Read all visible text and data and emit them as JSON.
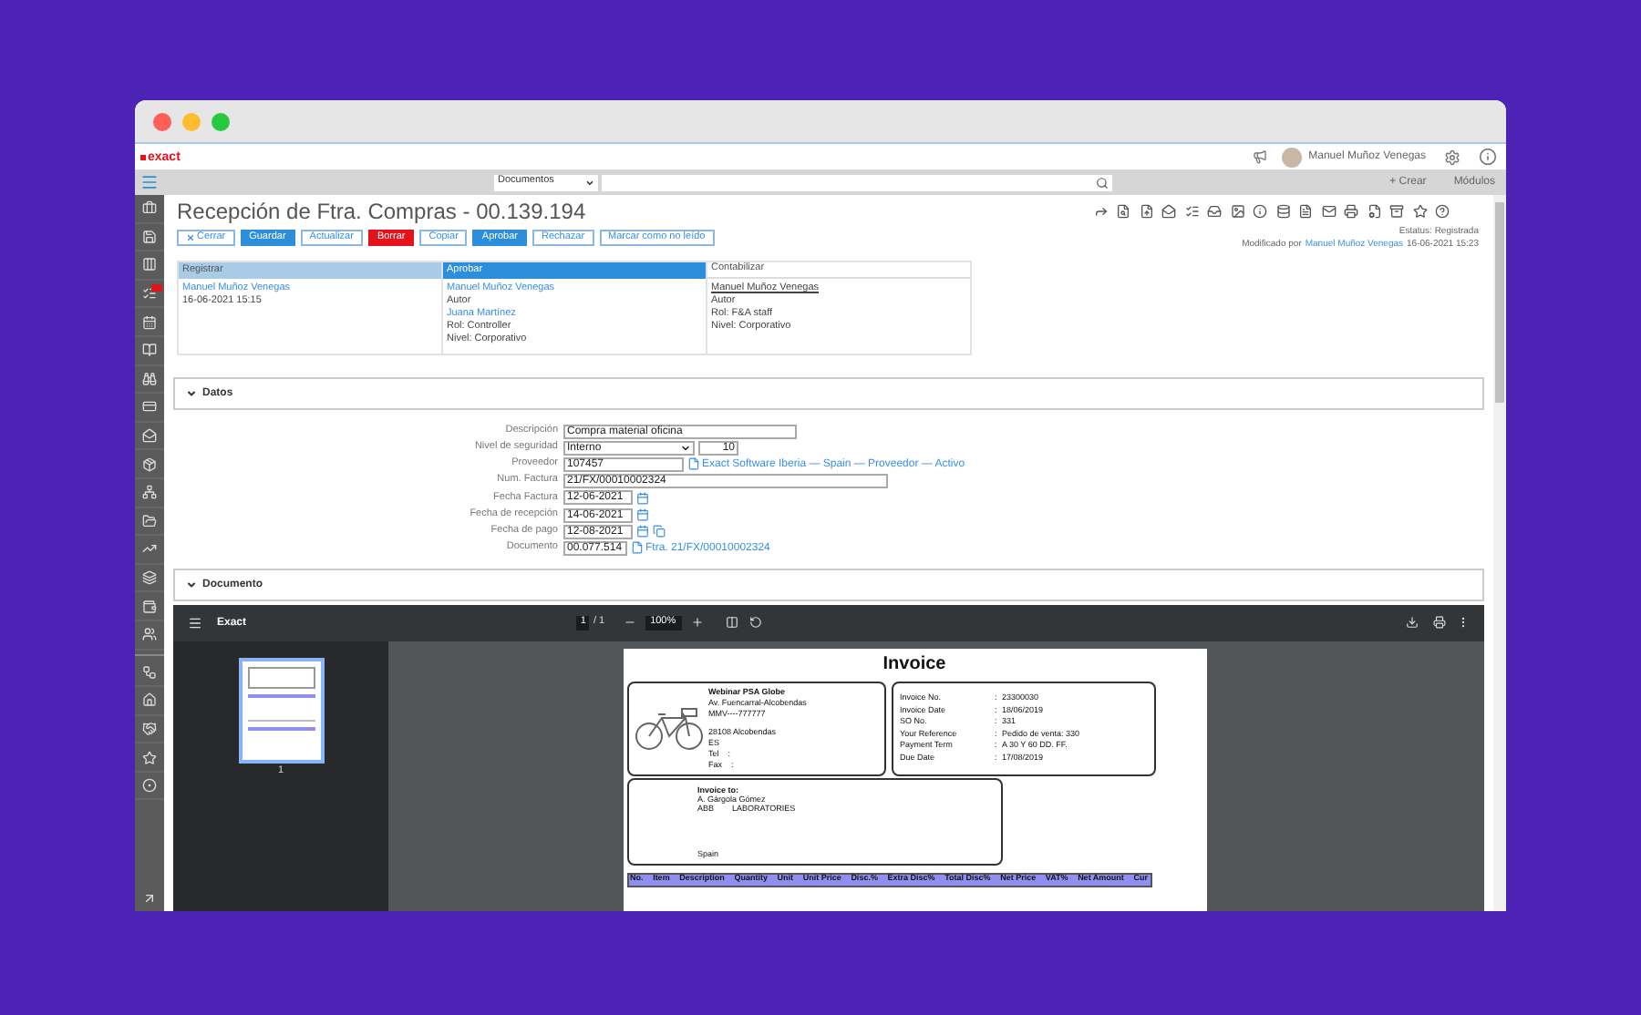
{
  "header": {
    "logo": "exact",
    "user_name": "Manuel Muñoz Venegas"
  },
  "nav": {
    "module_select": "Documentos",
    "create": "+ Crear",
    "modules": "Módulos"
  },
  "page": {
    "title": "Recepción de Ftra. Compras - 00.139.194"
  },
  "actions": [
    {
      "label": "Cerrar",
      "kind": "close"
    },
    {
      "label": "Guardar",
      "kind": "primary"
    },
    {
      "label": "Actualizar",
      "kind": "outline"
    },
    {
      "label": "Borrar",
      "kind": "danger"
    },
    {
      "label": "Copiar",
      "kind": "outline"
    },
    {
      "label": "Aprobar",
      "kind": "primary"
    },
    {
      "label": "Rechazar",
      "kind": "outline"
    },
    {
      "label": "Marcar como no leído",
      "kind": "outline"
    }
  ],
  "status": {
    "label": "Estatus: Registrada",
    "modified_prefix": "Modificado por",
    "modified_user": "Manuel Muñoz Venegas",
    "modified_date": "16-06-2021 15:23"
  },
  "workflow": [
    {
      "step": "Registrar",
      "completed": true,
      "current": false,
      "lines": [
        {
          "text": "Manuel Muñoz Venegas",
          "kind": "link"
        },
        {
          "text": "16-06-2021 15:15",
          "kind": "text"
        }
      ]
    },
    {
      "step": "Aprobar",
      "completed": false,
      "current": true,
      "lines": [
        {
          "text": "Manuel Muñoz Venegas",
          "kind": "link"
        },
        {
          "text": "Autor",
          "kind": "text"
        },
        {
          "text": "Juana Martínez",
          "kind": "link"
        },
        {
          "text": "Rol: Controller",
          "kind": "text"
        },
        {
          "text": "Nivel: Corporativo",
          "kind": "text"
        }
      ]
    },
    {
      "step": "Contabilizar",
      "completed": false,
      "current": false,
      "lines": [
        {
          "text": "Manuel Muñoz Venegas",
          "kind": "underline"
        },
        {
          "text": "Autor",
          "kind": "text"
        },
        {
          "text": "Rol: F&A staff",
          "kind": "text"
        },
        {
          "text": "Nivel: Corporativo",
          "kind": "text"
        }
      ]
    }
  ],
  "datos": {
    "title": "Datos",
    "expanded": true,
    "fields": [
      {
        "label": "Descripción",
        "kind": "text",
        "value": "Compra material oficina"
      },
      {
        "label": "Nivel de seguridad",
        "kind": "select",
        "value": "Interno",
        "extra": "10"
      },
      {
        "label": "Proveedor",
        "kind": "lookup",
        "value": "107457",
        "link": "Exact Software Iberia — Spain — Proveedor — Activo"
      },
      {
        "label": "Num. Factura",
        "kind": "long_text",
        "value": "21/FX/00010002324"
      },
      {
        "label": "Fecha Factura",
        "kind": "date",
        "value": "12-06-2021"
      },
      {
        "label": "Fecha de recepción",
        "kind": "date",
        "value": "14-06-2021"
      },
      {
        "label": "Fecha de pago",
        "kind": "date_copy",
        "value": "12-08-2021"
      },
      {
        "label": "Documento",
        "kind": "lookup_short",
        "value": "00.077.514",
        "link": "Ftra. 21/FX/00010002324"
      }
    ]
  },
  "documento": {
    "title": "Documento",
    "expanded": true
  },
  "viewer": {
    "title": "Exact",
    "page": "1",
    "pages": "/ 1",
    "zoom": "100%",
    "thumbnail_label": "1"
  },
  "invoice": {
    "title": "Invoice",
    "seller_name": "Webinar PSA Globe",
    "seller_address": [
      "Av. Fuencarral-Alcobendas",
      "MMV----777777"
    ],
    "seller_city": [
      "28108 Alcobendas",
      "ES",
      "Tel    :",
      "Fax    :"
    ],
    "separator": ":",
    "details": [
      {
        "label": "Invoice No.",
        "value": "23300030"
      },
      {
        "label": "Invoice Date",
        "value": "18/06/2019"
      },
      {
        "label": "SO No.",
        "value": "331"
      },
      {
        "label": "Your Reference",
        "value": "Pedido de venta: 330"
      },
      {
        "label": "Payment Term",
        "value": "A 30 Y 60 DD. FF."
      },
      {
        "label": "Due Date",
        "value": "17/08/2019"
      }
    ],
    "bill_to_heading": "Invoice to:",
    "bill_to_name": "A. Gárgola Gómez",
    "bill_to_company": [
      "ABB",
      "LABORATORIES"
    ],
    "bill_to_country": "Spain",
    "columns": [
      "No.",
      "Item",
      "Description",
      "Quantity",
      "Unit",
      "Unit Price",
      "Disc.%",
      "Extra Disc%",
      "Total Disc%",
      "Net Price",
      "VAT%",
      "Net Amount",
      "Cur"
    ]
  }
}
